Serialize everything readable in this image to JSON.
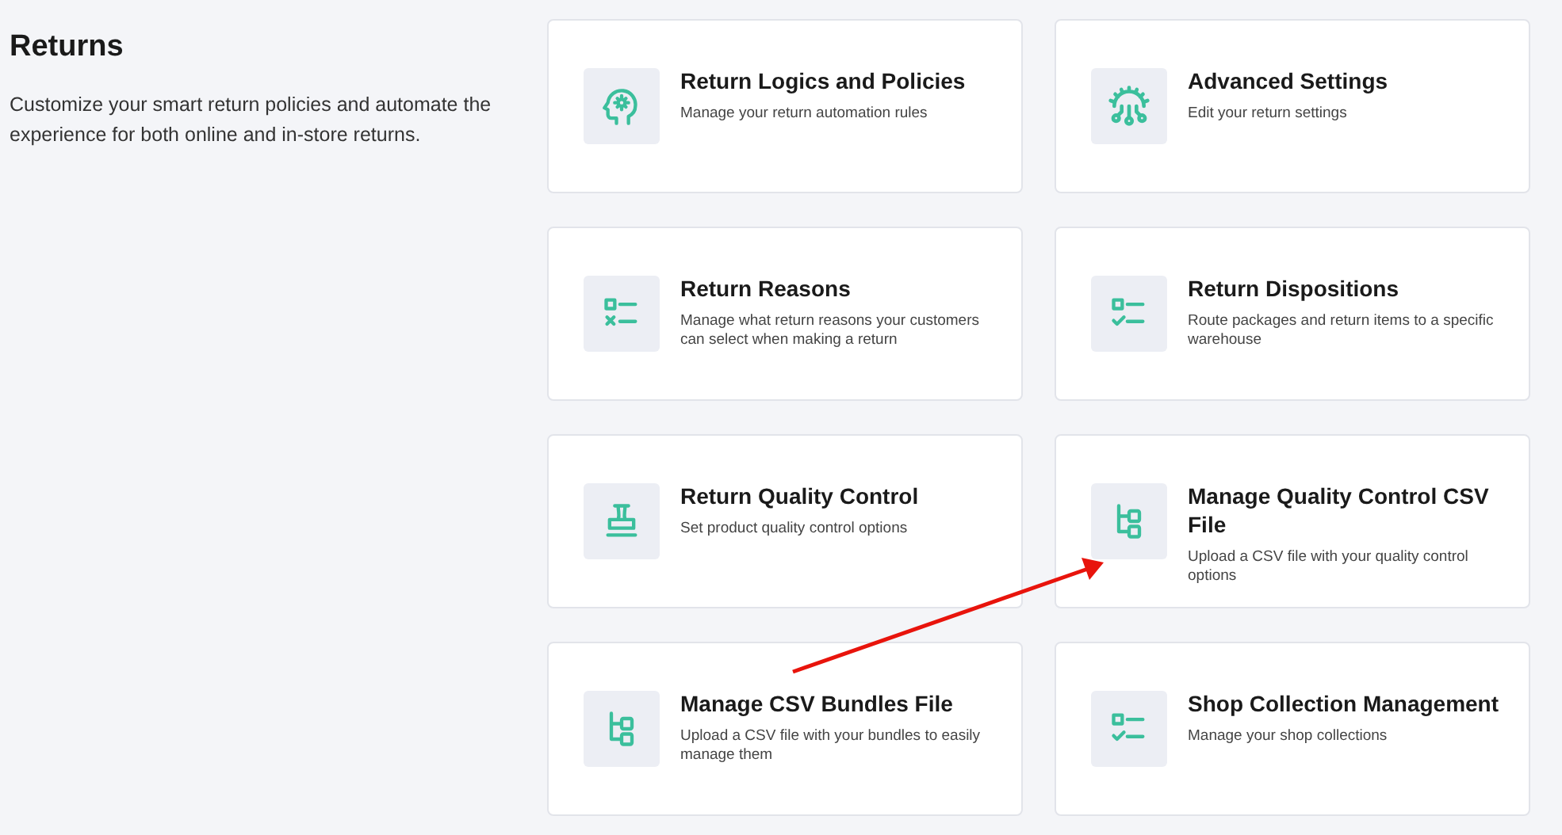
{
  "header": {
    "title": "Returns",
    "description": "Customize your smart return policies and automate the experience for both online and in-store returns."
  },
  "cards": [
    {
      "kind": "brain-gear",
      "title": "Return Logics and Policies",
      "description": "Manage your return automation rules"
    },
    {
      "kind": "gear-circuit",
      "title": "Advanced Settings",
      "description": "Edit your return settings"
    },
    {
      "kind": "list-cross",
      "title": "Return Reasons",
      "description": "Manage what return reasons your customers can select when making a return"
    },
    {
      "kind": "list-check",
      "title": "Return Dispositions",
      "description": "Route packages and return items to a specific warehouse"
    },
    {
      "kind": "stamp",
      "title": "Return Quality Control",
      "description": "Set product quality control options"
    },
    {
      "kind": "tree",
      "title": "Manage Quality Control CSV File",
      "description": "Upload a CSV file with your quality control options"
    },
    {
      "kind": "tree",
      "title": "Manage CSV Bundles File",
      "description": "Upload a CSV file with your bundles to easily manage them"
    },
    {
      "kind": "list-check",
      "title": "Shop Collection Management",
      "description": "Manage your shop collections"
    }
  ],
  "annotation": {
    "kind": "arrow"
  }
}
